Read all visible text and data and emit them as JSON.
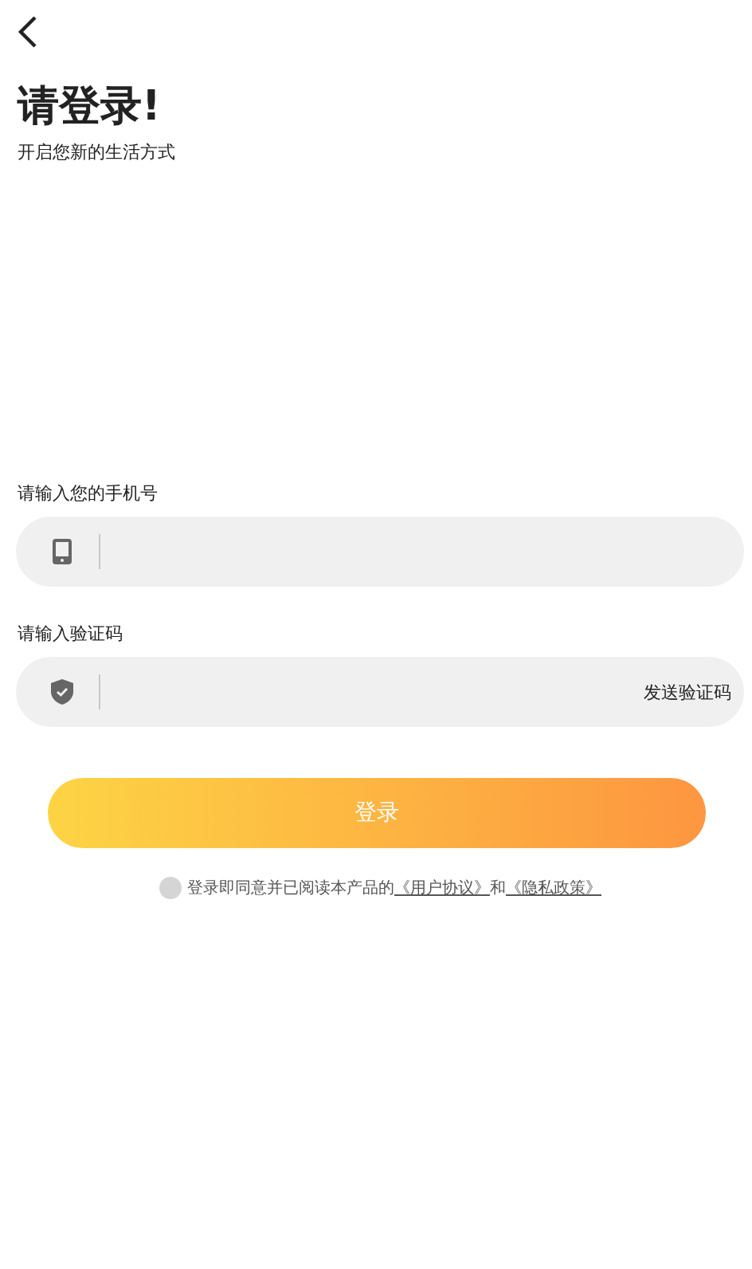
{
  "title": "请登录!",
  "subtitle": "开启您新的生活方式",
  "fields": [
    {
      "kind": "phone",
      "label": "请输入您的手机号"
    },
    {
      "kind": "code",
      "label": "请输入验证码",
      "action": "发送验证码"
    }
  ],
  "login_button": "登录",
  "agreement": {
    "checked": false,
    "text": "登录即同意并已阅读本产品的",
    "links": [
      "《用户协议》",
      "《隐私政策》"
    ],
    "joiner": "和"
  }
}
